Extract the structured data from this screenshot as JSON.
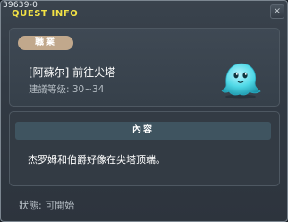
{
  "window": {
    "id": "39639-0",
    "title": "QUEST INFO",
    "close_label": "×"
  },
  "job": {
    "badge": "職業",
    "quest_name": "[阿蘇尔] 前往尖塔",
    "recommended_level": "建議等级: 30~34",
    "npc_icon": "blue-ghost-icon"
  },
  "content": {
    "header": "內容",
    "text": "杰罗姆和伯爵好像在尖塔顶端。"
  },
  "status": {
    "text": "狀態: 可開始"
  },
  "colors": {
    "title": "#f3e245",
    "badge": "#c1a88c",
    "header_bar": "#3f5460",
    "ghost": "#4fd8e6"
  }
}
